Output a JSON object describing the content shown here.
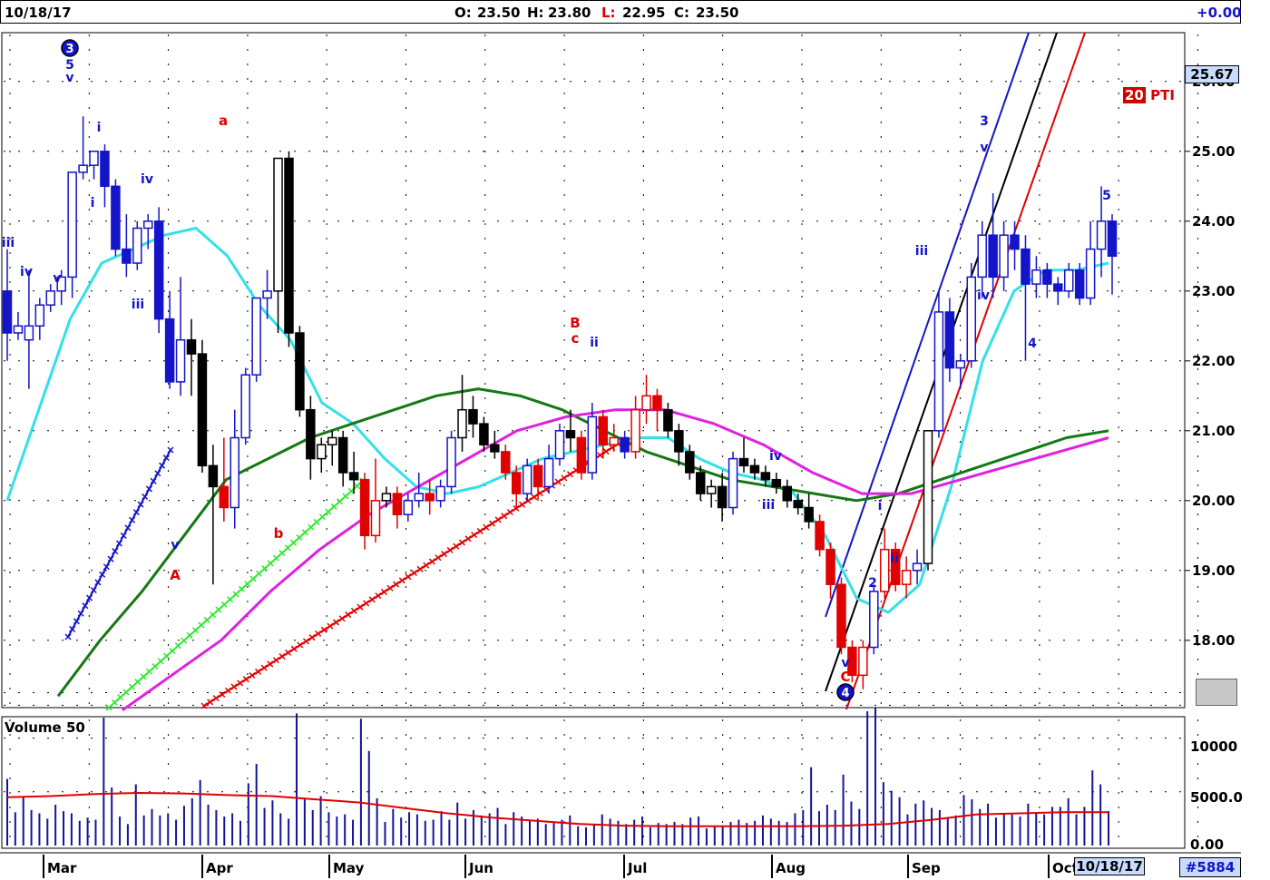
{
  "header": {
    "date": "10/18/17",
    "open_label": "O:",
    "open": "23.50",
    "high_label": "H:",
    "high": "23.80",
    "low_label": "L:",
    "low": "22.95",
    "close_label": "C:",
    "close": "23.50",
    "change": "+0.00"
  },
  "last_price": "25.67",
  "indicator": {
    "value": "20",
    "label": "PTI"
  },
  "volume_title": "Volume 50",
  "footer": {
    "date": "10/18/17",
    "symbol": "#5884"
  },
  "colors": {
    "up": "#1414c8",
    "down_black": "#000000",
    "down_red": "#e00000",
    "ma_cyan": "#33e0e8",
    "ma_green": "#147814",
    "ma_magenta": "#e020e0",
    "volume_avg": "#e00000"
  },
  "chart_data": [
    {
      "type": "candlestick",
      "x_ticks": [
        "Mar",
        "Apr",
        "May",
        "Jun",
        "Jul",
        "Aug",
        "Sep",
        "Oct"
      ],
      "y_ticks": [
        "18.00",
        "19.00",
        "20.00",
        "21.00",
        "22.00",
        "23.00",
        "24.00",
        "25.00",
        "26.00"
      ],
      "ylim": [
        17,
        26.3
      ],
      "grid": true,
      "series": [
        {
          "points": [
            [
              23.0,
              23.6,
              22.0,
              22.4,
              "b"
            ],
            [
              22.4,
              22.7,
              22.3,
              22.5,
              "b"
            ],
            [
              22.3,
              23.3,
              21.6,
              22.5,
              "b"
            ],
            [
              22.5,
              22.9,
              22.3,
              22.8,
              "b"
            ],
            [
              22.8,
              23.1,
              22.7,
              23.0,
              "b"
            ],
            [
              23.0,
              23.3,
              22.8,
              23.2,
              "b"
            ],
            [
              23.2,
              24.5,
              22.9,
              24.7,
              "b"
            ],
            [
              24.7,
              25.5,
              24.6,
              24.8,
              "b"
            ],
            [
              24.8,
              25.0,
              24.6,
              25.0,
              "b"
            ],
            [
              25.0,
              25.1,
              24.2,
              24.5,
              "b"
            ],
            [
              24.5,
              24.6,
              23.5,
              23.6,
              "b"
            ],
            [
              23.6,
              24.1,
              23.2,
              23.4,
              "b"
            ],
            [
              23.4,
              24.0,
              23.3,
              23.9,
              "b"
            ],
            [
              23.9,
              24.1,
              23.6,
              24.0,
              "b"
            ],
            [
              24.0,
              24.2,
              22.4,
              22.6,
              "b"
            ],
            [
              22.6,
              23.0,
              21.6,
              21.7,
              "b"
            ],
            [
              21.7,
              23.2,
              21.5,
              22.3,
              "b"
            ],
            [
              22.3,
              22.6,
              21.5,
              22.1,
              "k"
            ],
            [
              22.1,
              22.3,
              20.4,
              20.5,
              "k"
            ],
            [
              20.5,
              20.8,
              18.8,
              20.2,
              "k"
            ],
            [
              20.2,
              20.9,
              19.7,
              19.9,
              "r"
            ],
            [
              19.9,
              21.3,
              19.6,
              20.9,
              "b"
            ],
            [
              20.9,
              21.9,
              20.8,
              21.8,
              "b"
            ],
            [
              21.8,
              22.9,
              21.7,
              22.9,
              "b"
            ],
            [
              22.9,
              23.3,
              22.6,
              23.0,
              "b"
            ],
            [
              23.0,
              24.9,
              22.4,
              24.9,
              "k"
            ],
            [
              24.9,
              25.0,
              22.2,
              22.4,
              "k"
            ],
            [
              22.4,
              22.5,
              21.2,
              21.3,
              "k"
            ],
            [
              21.3,
              21.5,
              20.3,
              20.6,
              "k"
            ],
            [
              20.6,
              20.9,
              20.4,
              20.8,
              "k"
            ],
            [
              20.8,
              21.0,
              20.5,
              20.9,
              "k"
            ],
            [
              20.9,
              21.0,
              20.2,
              20.4,
              "k"
            ],
            [
              20.4,
              20.7,
              20.1,
              20.3,
              "k"
            ],
            [
              20.3,
              20.4,
              19.3,
              19.5,
              "r"
            ],
            [
              19.5,
              20.6,
              19.4,
              20.0,
              "r"
            ],
            [
              20.0,
              20.2,
              19.9,
              20.1,
              "k"
            ],
            [
              20.1,
              20.2,
              19.6,
              19.8,
              "r"
            ],
            [
              19.8,
              20.1,
              19.7,
              20.0,
              "b"
            ],
            [
              20.0,
              20.4,
              19.9,
              20.1,
              "b"
            ],
            [
              20.1,
              20.3,
              19.8,
              20.0,
              "r"
            ],
            [
              20.0,
              20.3,
              19.9,
              20.2,
              "b"
            ],
            [
              20.2,
              21.0,
              20.1,
              20.9,
              "b"
            ],
            [
              20.9,
              21.8,
              20.7,
              21.3,
              "k"
            ],
            [
              21.3,
              21.5,
              20.9,
              21.1,
              "k"
            ],
            [
              21.1,
              21.2,
              20.7,
              20.8,
              "k"
            ],
            [
              20.8,
              21.0,
              20.6,
              20.7,
              "k"
            ],
            [
              20.7,
              20.8,
              20.3,
              20.4,
              "r"
            ],
            [
              20.4,
              20.5,
              19.9,
              20.1,
              "r"
            ],
            [
              20.1,
              20.6,
              20.0,
              20.5,
              "b"
            ],
            [
              20.5,
              20.6,
              20.0,
              20.2,
              "r"
            ],
            [
              20.2,
              20.8,
              20.1,
              20.6,
              "b"
            ],
            [
              20.6,
              21.1,
              20.5,
              21.0,
              "b"
            ],
            [
              21.0,
              21.3,
              20.7,
              20.9,
              "k"
            ],
            [
              20.9,
              21.0,
              20.3,
              20.4,
              "r"
            ],
            [
              20.4,
              21.4,
              20.3,
              21.2,
              "b"
            ],
            [
              21.2,
              21.3,
              20.6,
              20.8,
              "r"
            ],
            [
              20.8,
              21.1,
              20.7,
              20.9,
              "r"
            ],
            [
              20.9,
              21.0,
              20.6,
              20.7,
              "b"
            ],
            [
              20.7,
              21.5,
              20.6,
              21.3,
              "r"
            ],
            [
              21.3,
              21.8,
              21.1,
              21.5,
              "r"
            ],
            [
              21.5,
              21.6,
              21.0,
              21.3,
              "r"
            ],
            [
              21.3,
              21.4,
              20.9,
              21.0,
              "k"
            ],
            [
              21.0,
              21.1,
              20.5,
              20.7,
              "k"
            ],
            [
              20.7,
              20.8,
              20.3,
              20.4,
              "k"
            ],
            [
              20.4,
              20.5,
              20.0,
              20.1,
              "k"
            ],
            [
              20.1,
              20.3,
              19.9,
              20.2,
              "k"
            ],
            [
              20.2,
              20.4,
              19.7,
              19.9,
              "k"
            ],
            [
              19.9,
              20.7,
              19.8,
              20.6,
              "b"
            ],
            [
              20.6,
              20.9,
              20.4,
              20.5,
              "k"
            ],
            [
              20.5,
              20.6,
              20.3,
              20.4,
              "k"
            ],
            [
              20.4,
              20.5,
              20.2,
              20.3,
              "k"
            ],
            [
              20.3,
              20.4,
              20.1,
              20.2,
              "k"
            ],
            [
              20.2,
              20.3,
              19.9,
              20.0,
              "k"
            ],
            [
              20.0,
              20.1,
              19.8,
              19.9,
              "k"
            ],
            [
              19.9,
              20.1,
              19.6,
              19.7,
              "k"
            ],
            [
              19.7,
              19.8,
              19.2,
              19.3,
              "r"
            ],
            [
              19.3,
              19.4,
              18.6,
              18.8,
              "r"
            ],
            [
              18.8,
              18.9,
              17.8,
              17.9,
              "r"
            ],
            [
              17.9,
              18.0,
              17.4,
              17.5,
              "r"
            ],
            [
              17.5,
              18.0,
              17.3,
              17.9,
              "r"
            ],
            [
              17.9,
              18.8,
              17.8,
              18.7,
              "b"
            ],
            [
              18.7,
              19.6,
              18.6,
              19.3,
              "r"
            ],
            [
              19.3,
              19.4,
              18.7,
              18.8,
              "r"
            ],
            [
              18.8,
              19.2,
              18.6,
              19.0,
              "r"
            ],
            [
              19.0,
              19.3,
              18.8,
              19.1,
              "b"
            ],
            [
              19.1,
              21.0,
              19.0,
              21.0,
              "k"
            ],
            [
              21.0,
              23.0,
              20.9,
              22.7,
              "b"
            ],
            [
              22.7,
              22.9,
              21.7,
              21.9,
              "b"
            ],
            [
              21.9,
              22.1,
              21.6,
              22.0,
              "b"
            ],
            [
              22.0,
              23.4,
              21.9,
              23.2,
              "b"
            ],
            [
              23.2,
              24.0,
              22.9,
              23.8,
              "b"
            ],
            [
              23.8,
              24.4,
              22.9,
              23.2,
              "b"
            ],
            [
              23.2,
              24.0,
              23.0,
              23.8,
              "b"
            ],
            [
              23.8,
              24.0,
              23.3,
              23.6,
              "b"
            ],
            [
              23.6,
              23.8,
              22.0,
              23.1,
              "b"
            ],
            [
              23.1,
              23.5,
              22.9,
              23.3,
              "b"
            ],
            [
              23.3,
              23.4,
              22.9,
              23.1,
              "b"
            ],
            [
              23.1,
              23.2,
              22.8,
              23.0,
              "b"
            ],
            [
              23.0,
              23.4,
              22.9,
              23.3,
              "b"
            ],
            [
              23.3,
              23.4,
              22.8,
              22.9,
              "b"
            ],
            [
              22.9,
              24.0,
              22.8,
              23.6,
              "b"
            ],
            [
              23.6,
              24.5,
              23.2,
              24.0,
              "b"
            ],
            [
              24.0,
              24.1,
              22.95,
              23.5,
              "b"
            ]
          ]
        },
        {
          "name": "",
          "type": "line",
          "color": "cyan",
          "values": [
            20.0,
            21.3,
            22.6,
            23.4,
            23.6,
            23.8,
            23.9,
            23.5,
            22.8,
            22.3,
            21.4,
            21.1,
            20.6,
            20.2,
            20.1,
            20.2,
            20.4,
            20.6,
            20.7,
            20.8,
            20.9,
            20.9,
            20.6,
            20.4,
            20.3,
            20.1,
            19.5,
            18.6,
            18.4,
            18.8,
            20.2,
            22.0,
            23.0,
            23.3,
            23.3,
            23.4
          ]
        },
        {
          "name": "",
          "type": "line",
          "color": "green",
          "values": [
            17.2,
            18.0,
            18.7,
            19.5,
            20.3,
            20.6,
            20.9,
            21.1,
            21.3,
            21.5,
            21.6,
            21.5,
            21.3,
            21.0,
            20.7,
            20.5,
            20.3,
            20.2,
            20.1,
            20.0,
            20.1,
            20.3,
            20.5,
            20.7,
            20.9,
            21.0
          ]
        },
        {
          "name": "",
          "type": "line",
          "color": "magenta",
          "values": [
            17.0,
            17.5,
            18.0,
            18.7,
            19.3,
            19.8,
            20.2,
            20.6,
            21.0,
            21.2,
            21.3,
            21.3,
            21.1,
            20.8,
            20.4,
            20.1,
            20.1,
            20.3,
            20.5,
            20.7,
            20.9
          ]
        }
      ]
    },
    {
      "type": "bar",
      "title": "Volume 50",
      "y_ticks": [
        "0.00",
        "5000.0",
        "10000"
      ],
      "ylim": [
        0,
        12500
      ],
      "values": [
        6200,
        3100,
        4500,
        3300,
        3000,
        2500,
        3800,
        3200,
        3000,
        2300,
        2600,
        2400,
        11900,
        5400,
        2700,
        2000,
        5700,
        2800,
        3400,
        2800,
        3000,
        2400,
        3700,
        4400,
        6100,
        3800,
        3300,
        2700,
        3000,
        2300,
        5800,
        7600,
        3500,
        4200,
        3000,
        2500,
        12300,
        4300,
        3300,
        4600,
        3100,
        2700,
        2900,
        2400,
        11800,
        8800,
        4400,
        2200,
        3400,
        2600,
        3100,
        2900,
        2300,
        2400,
        3200,
        2400,
        4000,
        2500,
        3300,
        2800,
        3000,
        3500,
        2000,
        3100,
        2700,
        2400,
        2500,
        2000,
        2100,
        2400,
        2800,
        1800,
        1700,
        2000,
        2900,
        2500,
        2300,
        2000,
        2400,
        2700,
        1700,
        2100,
        2000,
        2200,
        2000,
        2600,
        2700,
        1600,
        1800,
        1800,
        2200,
        2400,
        2100,
        2300,
        2800,
        2500,
        2300,
        2200,
        3000,
        3300,
        7300,
        3200,
        3800,
        3300,
        6600,
        4100,
        3400,
        12500,
        12800,
        5900,
        5100,
        4500,
        2900,
        3900,
        4200,
        3500,
        3300,
        2600,
        2800,
        4700,
        4300,
        3400,
        3900,
        2600,
        3000,
        2900,
        2700,
        3900,
        3000,
        2900,
        3600,
        3600,
        4400,
        2900,
        3600,
        7000,
        5700,
        3200
      ],
      "avg_values": [
        4500,
        4600,
        4800,
        4900,
        4850,
        4700,
        4600,
        4300,
        4000,
        3500,
        3000,
        2600,
        2300,
        2000,
        1850,
        1800,
        1800,
        1800,
        1800,
        1850,
        2000,
        2400,
        2900,
        3000,
        3100,
        3100
      ]
    }
  ],
  "annotations": {
    "circles": [
      {
        "text": "3"
      },
      {
        "text": "4"
      }
    ],
    "blue": [
      "iii",
      "5",
      "v",
      "i",
      "iv",
      "iii",
      "v",
      "i",
      "iv",
      "ii",
      "v",
      "ii",
      "iv",
      "iii",
      "v",
      "i",
      "2",
      "iii",
      "ii",
      "3",
      "v",
      "iii",
      "iv",
      "4",
      "5"
    ],
    "red": [
      "a",
      "A",
      "b",
      "B",
      "c",
      "C"
    ]
  }
}
